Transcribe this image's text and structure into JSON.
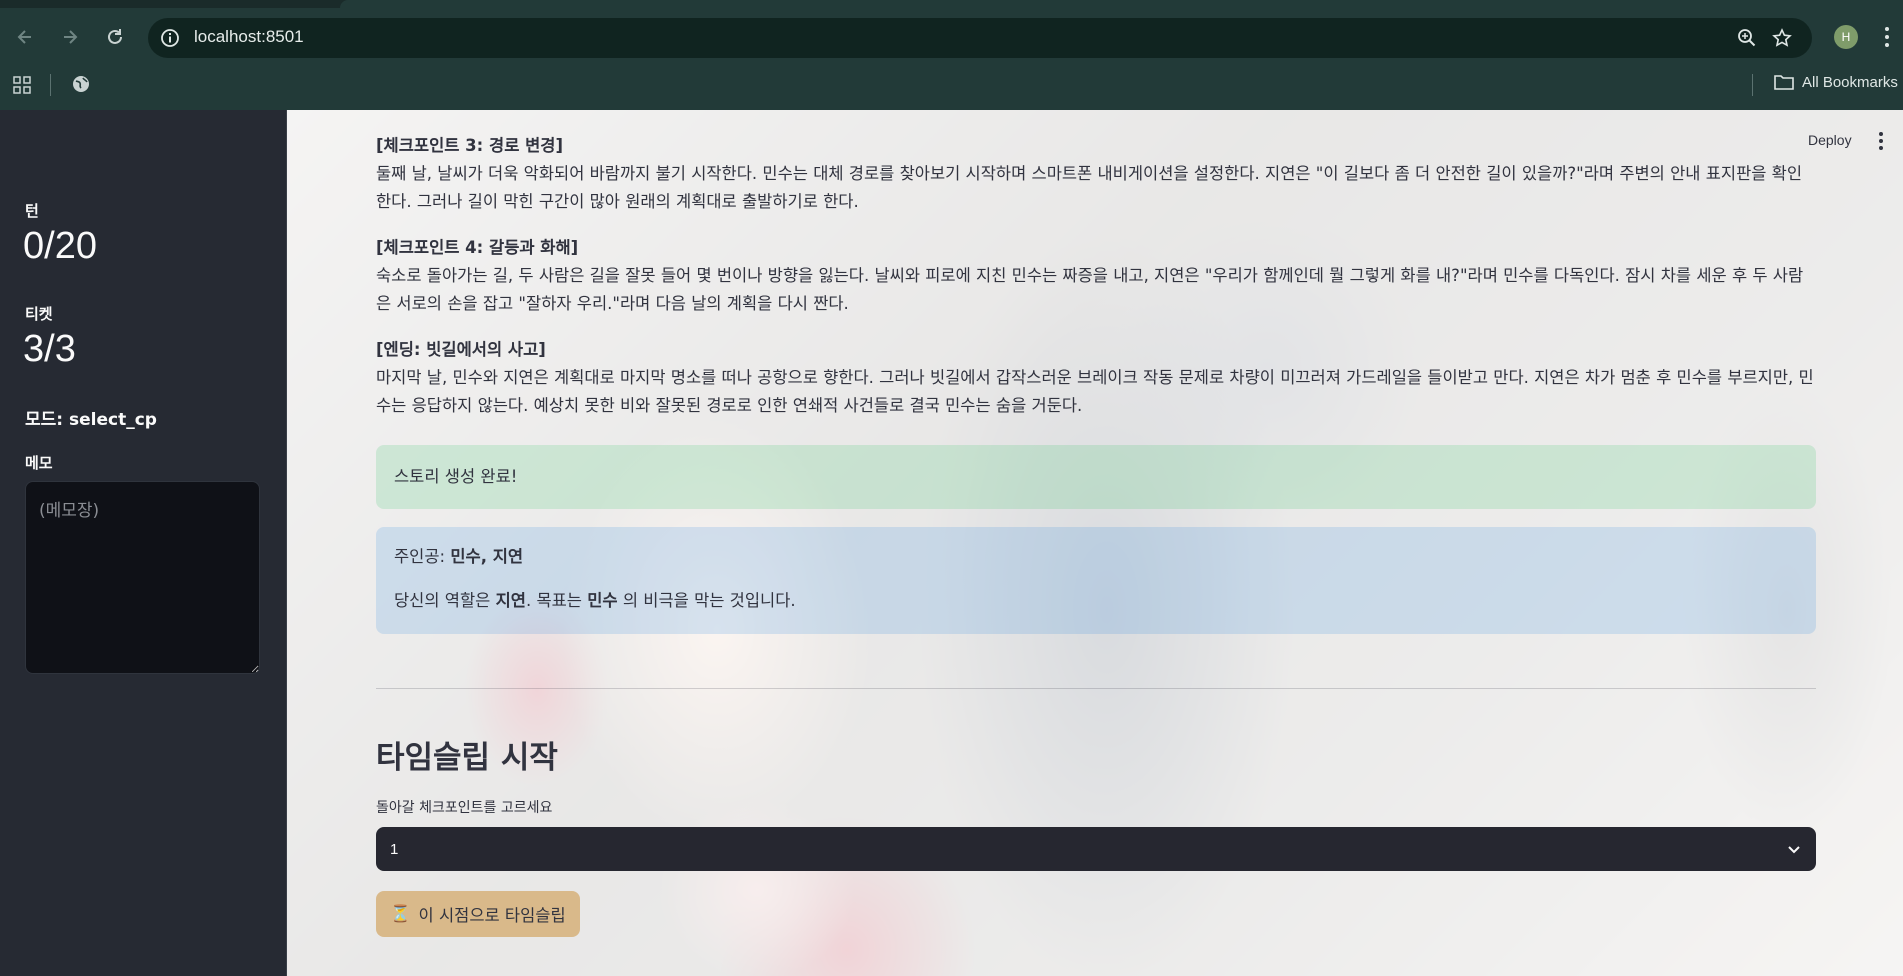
{
  "browser": {
    "url": "localhost:8501",
    "profile_initial": "H",
    "all_bookmarks_label": "All Bookmarks"
  },
  "sidebar": {
    "turn_label": "턴",
    "turn_value": "0/20",
    "ticket_label": "티켓",
    "ticket_value": "3/3",
    "mode_text": "모드: select_cp",
    "memo_label": "메모",
    "memo_placeholder": "(메모장)"
  },
  "header": {
    "deploy_label": "Deploy"
  },
  "story": [
    {
      "title": "[체크포인트 3: 경로 변경]",
      "body": "둘째 날, 날씨가 더욱 악화되어 바람까지 불기 시작한다. 민수는 대체 경로를 찾아보기 시작하며 스마트폰 내비게이션을 설정한다. 지연은 \"이 길보다 좀 더 안전한 길이 있을까?\"라며 주변의 안내 표지판을 확인한다. 그러나 길이 막힌 구간이 많아 원래의 계획대로 출발하기로 한다."
    },
    {
      "title": "[체크포인트 4: 갈등과 화해]",
      "body": "숙소로 돌아가는 길, 두 사람은 길을 잘못 들어 몇 번이나 방향을 잃는다. 날씨와 피로에 지친 민수는 짜증을 내고, 지연은 \"우리가 함께인데 뭘 그렇게 화를 내?\"라며 민수를 다독인다. 잠시 차를 세운 후 두 사람은 서로의 손을 잡고 \"잘하자 우리.\"라며 다음 날의 계획을 다시 짠다."
    },
    {
      "title": "[엔딩: 빗길에서의 사고]",
      "body": "마지막 날, 민수와 지연은 계획대로 마지막 명소를 떠나 공항으로 향한다. 그러나 빗길에서 갑작스러운 브레이크 작동 문제로 차량이 미끄러져 가드레일을 들이받고 만다. 지연은 차가 멈춘 후 민수를 부르지만, 민수는 응답하지 않는다. 예상치 못한 비와 잘못된 경로로 인한 연쇄적 사건들로 결국 민수는 숨을 거둔다."
    }
  ],
  "success_alert": "스토리 생성 완료!",
  "info_alert": {
    "protagonist_prefix": "주인공: ",
    "protagonists": "민수, 지연",
    "role_prefix": "당신의 역할은 ",
    "role_name": "지연",
    "role_mid": ". 목표는 ",
    "target_name": "민수",
    "role_suffix": " 의 비극을 막는 것입니다."
  },
  "timeslip": {
    "title": "타임슬립 시작",
    "select_label": "돌아갈 체크포인트를 고르세요",
    "selected_value": "1",
    "button_icon": "⏳",
    "button_label": "이 시점으로 타임슬립"
  },
  "colors": {
    "sidebar_bg": "#262a33",
    "success_bg": "#d7f0dd",
    "info_bg": "#d3e4f5",
    "select_bg": "#262730",
    "button_bg": "#d9b98a"
  }
}
